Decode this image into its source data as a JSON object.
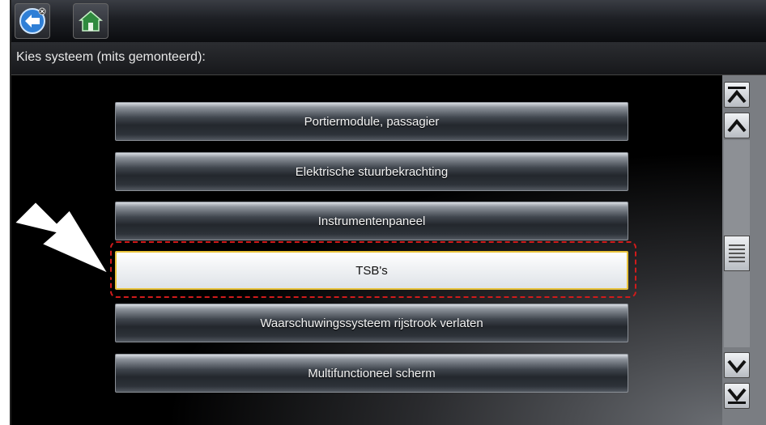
{
  "toolbar": {
    "back_icon": "back-arrow-icon",
    "home_icon": "home-icon"
  },
  "header": {
    "title": "Kies systeem (mits gemonteerd):"
  },
  "menu": {
    "items": [
      {
        "label": "Portiermodule, passagier",
        "selected": false
      },
      {
        "label": "Elektrische stuurbekrachting",
        "selected": false
      },
      {
        "label": "Instrumentenpaneel",
        "selected": false
      },
      {
        "label": "TSB's",
        "selected": true
      },
      {
        "label": "Waarschuwingssysteem rijstrook verlaten",
        "selected": false
      },
      {
        "label": "Multifunctioneel scherm",
        "selected": false
      }
    ]
  },
  "scrollbar": {
    "icons": [
      "scroll-top-icon",
      "scroll-up-icon",
      "scroll-thumb-icon",
      "scroll-down-icon",
      "scroll-bottom-icon"
    ]
  },
  "annotation": {
    "callout_icon": "callout-arrow-icon",
    "highlight_color": "#d11b1b"
  },
  "colors": {
    "selected_border": "#e8c23a",
    "background": "#000000"
  }
}
